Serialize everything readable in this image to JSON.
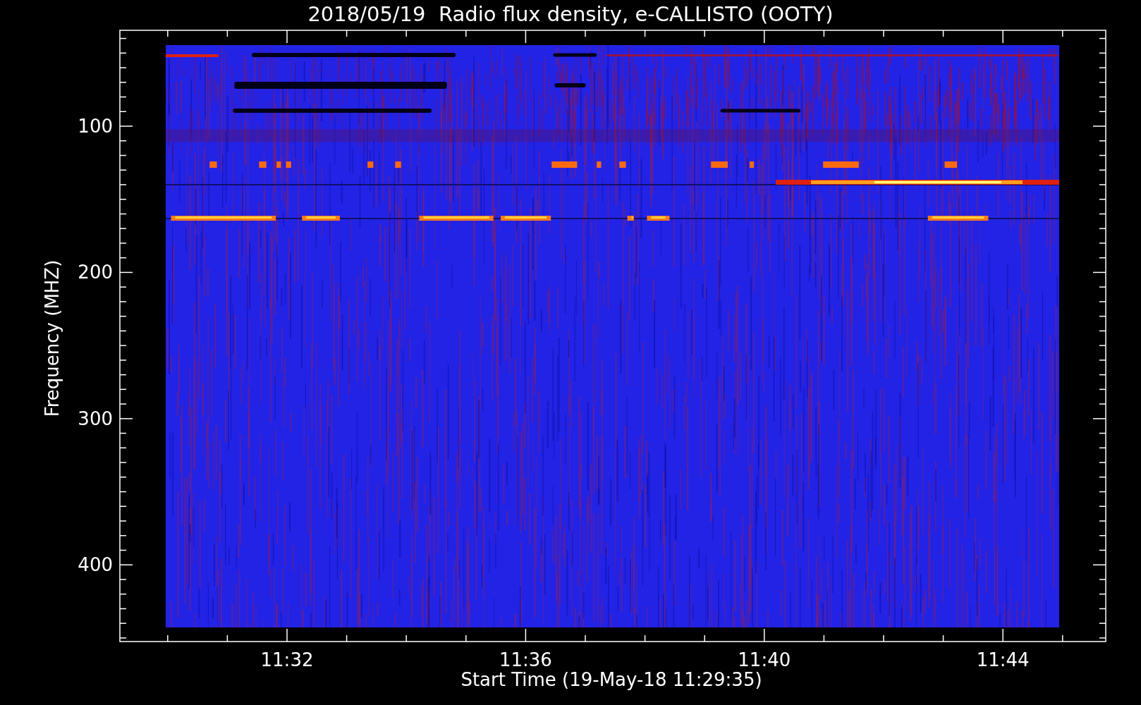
{
  "title": "2018/05/19  Radio flux density, e-CALLISTO (OOTY)",
  "y_axis": {
    "label": "Frequency (MHZ)",
    "ticks": [
      "100",
      "200",
      "300",
      "400"
    ]
  },
  "x_axis": {
    "label": "Start Time (19-May-18 11:29:35)",
    "ticks": [
      "11:32",
      "11:36",
      "11:40",
      "11:44"
    ]
  }
}
